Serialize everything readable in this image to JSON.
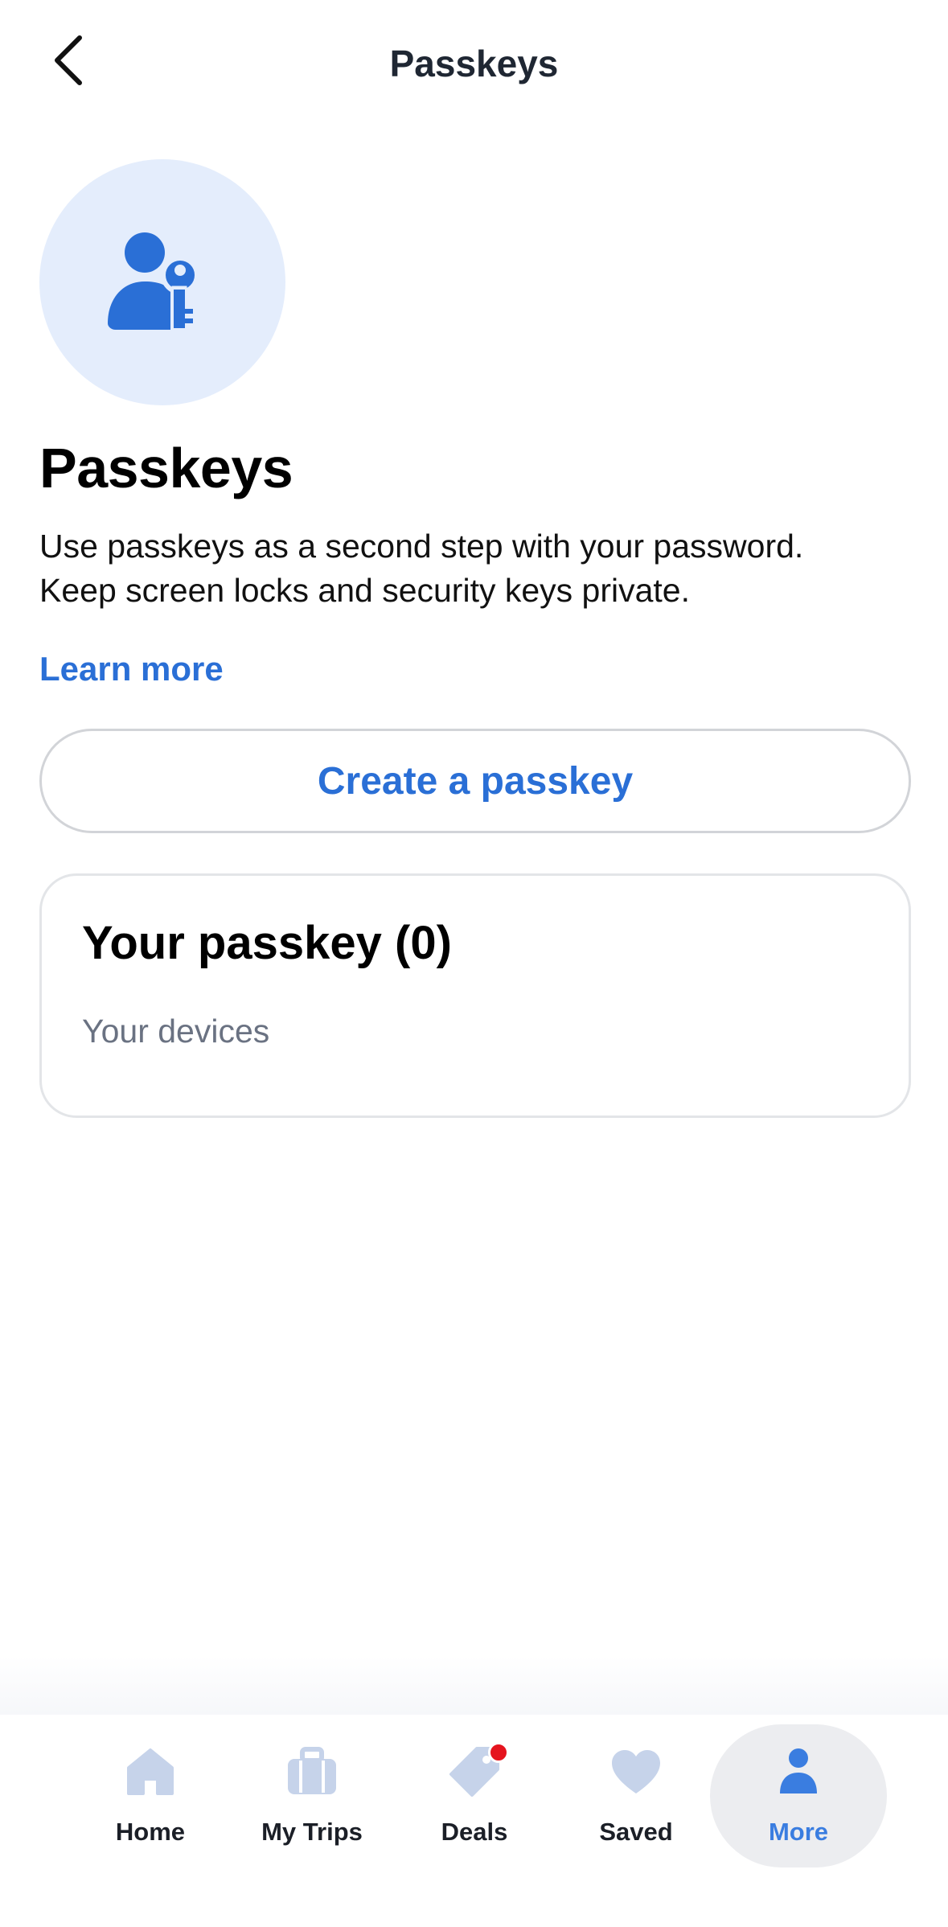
{
  "header": {
    "title": "Passkeys",
    "back_icon": "chevron-left-icon"
  },
  "hero": {
    "icon": "user-key-icon",
    "circle_color": "#e4edfc",
    "icon_color": "#2a6fd6"
  },
  "main": {
    "heading": "Passkeys",
    "description_line1": "Use passkeys as a second step with your password.",
    "description_line2": "Keep screen locks and security keys private.",
    "learn_more_label": "Learn more",
    "create_button_label": "Create a passkey"
  },
  "passkey_card": {
    "title": "Your passkey (0)",
    "subtitle": "Your devices"
  },
  "bottom_nav": {
    "items": [
      {
        "label": "Home",
        "icon": "home-icon",
        "active": false
      },
      {
        "label": "My Trips",
        "icon": "suitcase-icon",
        "active": false
      },
      {
        "label": "Deals",
        "icon": "tag-icon",
        "active": false,
        "badge": true
      },
      {
        "label": "Saved",
        "icon": "heart-icon",
        "active": false
      },
      {
        "label": "More",
        "icon": "person-icon",
        "active": true
      }
    ],
    "inactive_icon_color": "#c6d3ea",
    "active_color": "#3a7de0",
    "badge_color": "#e5141e"
  }
}
